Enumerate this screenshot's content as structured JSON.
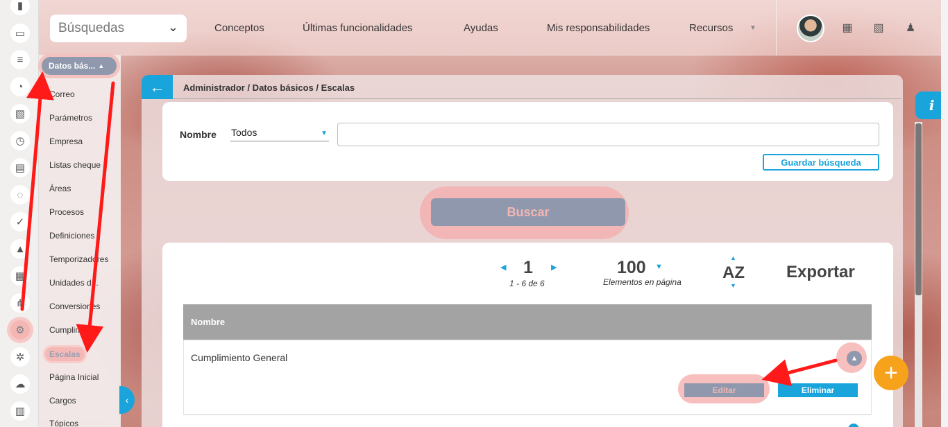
{
  "header": {
    "search_select": "Búsquedas",
    "nav": [
      "Conceptos",
      "Últimas funcionalidades",
      "Ayudas",
      "Mis responsabilidades",
      "Recursos"
    ]
  },
  "sidebar": {
    "section_label": "Datos bás...",
    "items": [
      "Correo",
      "Parámetros",
      "Empresa",
      "Listas cheque",
      "Áreas",
      "Procesos",
      "Definiciones",
      "Temporizadores",
      "Unidades d...",
      "Conversiones",
      "Cumplimiento",
      "Escalas",
      "Página Inicial",
      "Cargos",
      "Tópicos"
    ]
  },
  "breadcrumb": "Administrador / Datos básicos / Escalas",
  "filter": {
    "label": "Nombre",
    "select_value": "Todos",
    "input_value": "",
    "save_button": "Guardar búsqueda"
  },
  "search_button": "Buscar",
  "pager": {
    "page": "1",
    "range": "1 - 6 de 6",
    "per_page": "100",
    "per_page_label": "Elementos en página",
    "sort_label": "AZ",
    "export_label": "Exportar"
  },
  "table": {
    "header": "Nombre",
    "rows": [
      {
        "name": "Cumplimiento General",
        "edit": "Editar",
        "delete": "Eliminar"
      }
    ]
  },
  "fab": "+",
  "info_tab": "i",
  "colors": {
    "accent": "#1aa4dc",
    "fab": "#f7a21b",
    "highlight": "#f4b7b4",
    "annotation_arrow": "#ff1a1a",
    "disabled_button": "#8f98ad"
  }
}
